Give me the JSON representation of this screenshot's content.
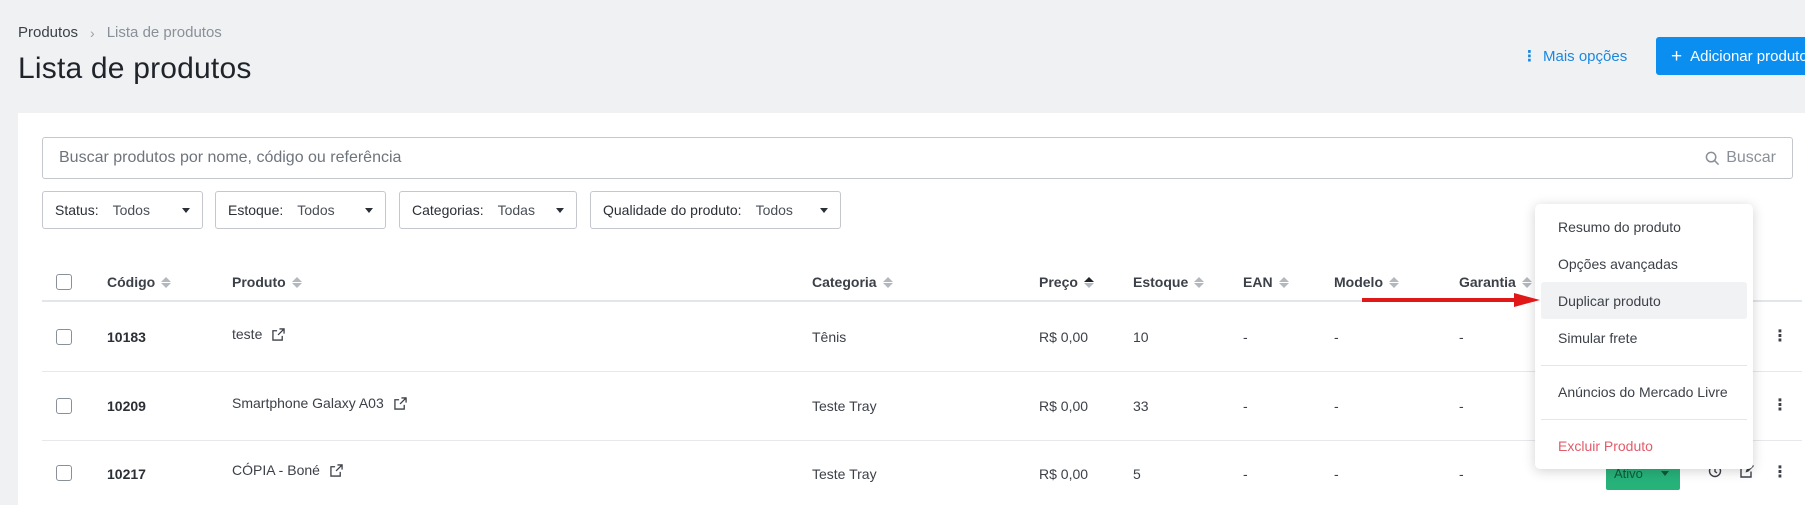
{
  "breadcrumb": {
    "root": "Produtos",
    "separator": "›",
    "current": "Lista de produtos"
  },
  "page_title": "Lista de produtos",
  "header_actions": {
    "more_options": "Mais opções",
    "add_product": "Adicionar produto"
  },
  "search": {
    "placeholder": "Buscar produtos por nome, código ou referência",
    "button": "Buscar"
  },
  "filters": [
    {
      "label": "Status:",
      "value": "Todos"
    },
    {
      "label": "Estoque:",
      "value": "Todos"
    },
    {
      "label": "Categorias:",
      "value": "Todas"
    },
    {
      "label": "Qualidade do produto:",
      "value": "Todos"
    }
  ],
  "table": {
    "columns": [
      "Código",
      "Produto",
      "Categoria",
      "Preço",
      "Estoque",
      "EAN",
      "Modelo",
      "Garantia"
    ],
    "active_sort": "Preço",
    "rows": [
      {
        "codigo": "10183",
        "produto": "teste",
        "categoria": "Tênis",
        "preco": "R$ 0,00",
        "estoque": "10",
        "ean": "-",
        "modelo": "-",
        "garantia": "-"
      },
      {
        "codigo": "10209",
        "produto": "Smartphone Galaxy A03",
        "categoria": "Teste Tray",
        "preco": "R$ 0,00",
        "estoque": "33",
        "ean": "-",
        "modelo": "-",
        "garantia": "-"
      },
      {
        "codigo": "10217",
        "produto": "CÓPIA - Boné",
        "categoria": "Teste Tray",
        "preco": "R$ 0,00",
        "estoque": "5",
        "ean": "-",
        "modelo": "-",
        "garantia": "-"
      }
    ],
    "row3_status": "Ativo"
  },
  "context_menu": {
    "items": [
      "Resumo do produto",
      "Opções avançadas",
      "Duplicar produto",
      "Simular frete",
      "Anúncios do Mercado Livre",
      "Excluir Produto"
    ],
    "highlighted": "Duplicar produto"
  },
  "colors": {
    "accent": "#0a8ef0",
    "link": "#1a88e0",
    "danger": "#e25c6a",
    "status_active": "#27b27a",
    "annotation_arrow": "#e01818"
  },
  "icons": [
    "chevron-right-icon",
    "kebab-icon",
    "plus-icon",
    "search-icon",
    "caret-down-icon",
    "sort-icon",
    "external-link-icon",
    "history-icon",
    "edit-icon"
  ]
}
